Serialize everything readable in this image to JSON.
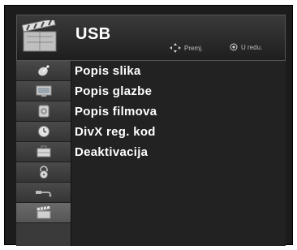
{
  "header": {
    "title": "USB",
    "hint_move": "Premj.",
    "hint_ok": "U redu."
  },
  "sidebar": {
    "items": [
      {
        "icon": "satellite-dish-icon",
        "active": false
      },
      {
        "icon": "tv-screen-icon",
        "active": false
      },
      {
        "icon": "speaker-icon",
        "active": false
      },
      {
        "icon": "clock-icon",
        "active": false
      },
      {
        "icon": "briefcase-icon",
        "active": false
      },
      {
        "icon": "lock-icon",
        "active": false
      },
      {
        "icon": "usb-plug-icon",
        "active": false
      },
      {
        "icon": "clapperboard-icon",
        "active": true
      }
    ]
  },
  "menu": {
    "items": [
      {
        "label": "Popis slika"
      },
      {
        "label": "Popis glazbe"
      },
      {
        "label": "Popis filmova"
      },
      {
        "label": "DivX reg. kod"
      },
      {
        "label": "Deaktivacija"
      }
    ]
  },
  "colors": {
    "panel_bg": "#1c1c1c",
    "content_bg": "#222222",
    "sidebar_bg": "#3a3a3a",
    "text": "#ffffff",
    "hint_text": "#bdbdbd"
  }
}
